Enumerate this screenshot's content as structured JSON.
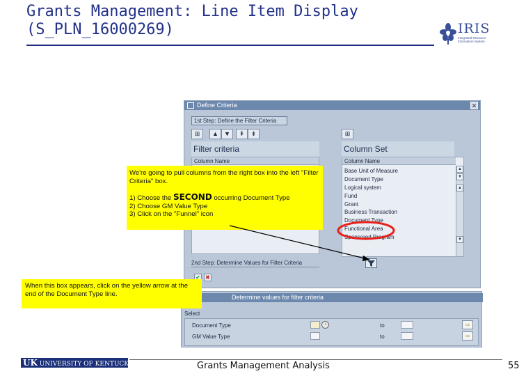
{
  "slide": {
    "title_line1": "Grants Management: Line Item Display",
    "title_line2": "(S_PLN_16000269)",
    "footer_text": "Grants Management Analysis",
    "page_number": "55"
  },
  "logos": {
    "iris_word": "IRIS",
    "iris_sub": "Integrated Resource Information System",
    "uk_logo_text_prefix": "UK",
    "uk_logo_text": "UNIVERSITY OF KENTUCKY"
  },
  "dialog": {
    "title": "Define Criteria",
    "step1_label": "1st Step: Define the Filter Criteria",
    "filter_pane_title": "Filter criteria",
    "filter_col_header": "Column Name",
    "column_pane_title": "Column Set",
    "column_col_header": "Column Name",
    "column_items": [
      "Base Unit of Measure",
      "Document Type",
      "Logical system",
      "Fund",
      "Grant",
      "Business Transaction",
      "Document Type",
      "Functional Area",
      "Sponsored Program"
    ],
    "step2_label": "2nd Step: Determine Values for Filter Criteria",
    "close_glyph": "✕",
    "toolbar_glyphs": [
      "⊞",
      "▲",
      "▲",
      "⇞",
      "⇟"
    ]
  },
  "selection": {
    "title": "Determine values for filter criteria",
    "tab_label": "Select",
    "rows": [
      {
        "label": "Document Type",
        "to_label": "to"
      },
      {
        "label": "GM Value Type",
        "to_label": "to"
      }
    ]
  },
  "notes": {
    "note1_intro": "We're going to pull columns from the right box into the left \"Filter Criteria\" box.",
    "note1_step1_prefix": "1)  Choose the ",
    "note1_step1_emph": "SECOND",
    "note1_step1_suffix": " occurring Document Type",
    "note1_step2": "2)  Choose GM Value Type",
    "note1_step3": "3)  Click on the \"Funnel\" icon",
    "note2": "When this box appears, click on the yellow arrow at the end of the Document Type line."
  },
  "colors": {
    "title_blue": "#22318a",
    "note_yellow": "#ffff00",
    "highlight_red": "#e8201a",
    "sap_panel": "#b9c7d9"
  }
}
